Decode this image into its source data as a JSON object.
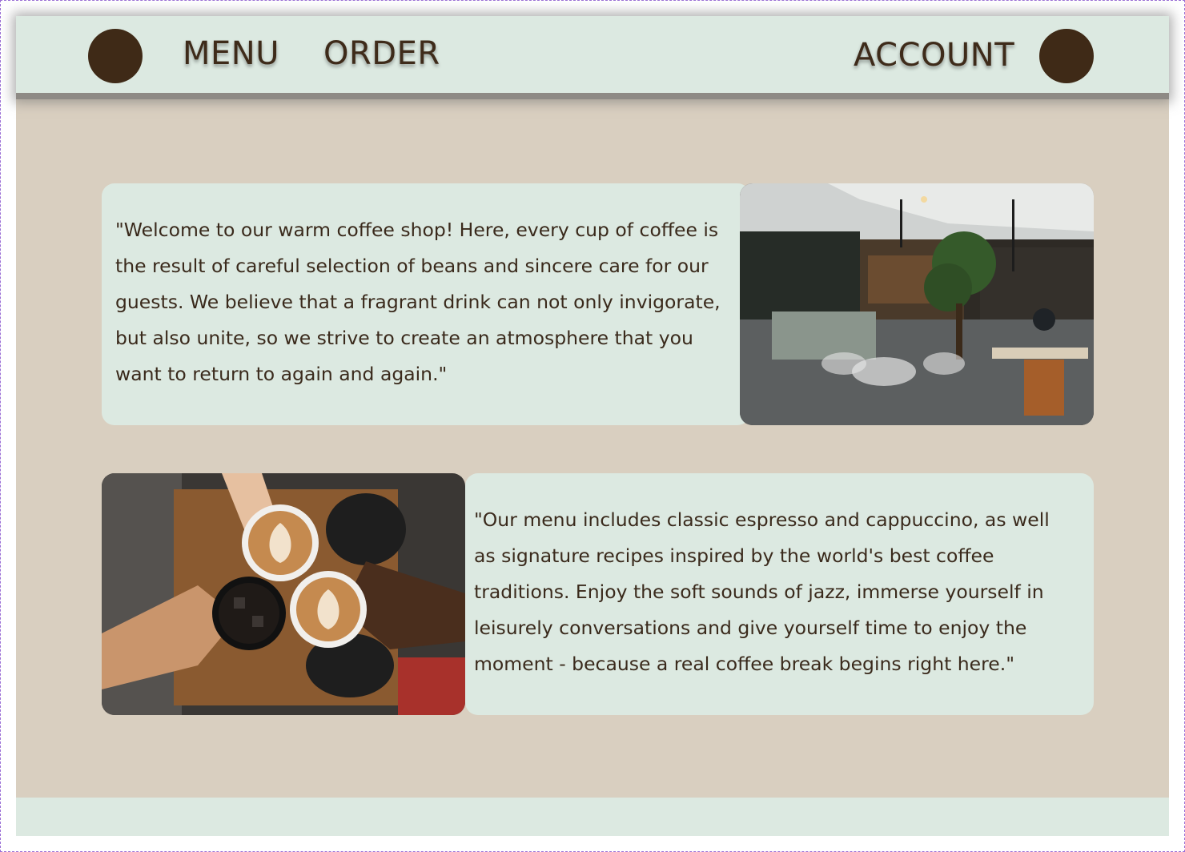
{
  "header": {
    "nav": [
      {
        "label": "MENU"
      },
      {
        "label": "ORDER"
      }
    ],
    "account_label": "ACCOUNT"
  },
  "sections": [
    {
      "text": "\"Welcome to our warm coffee shop! Here, every cup of coffee is the result of careful selection of beans and sincere care for our guests. We believe that a fragrant drink can not only invigorate, but also unite, so we strive to create an atmosphere that you want to return to again and again.\""
    },
    {
      "text": "\"Our menu includes classic espresso and cappuccino, as well as signature recipes inspired by the world's best coffee traditions. Enjoy the soft sounds of jazz, immerse yourself in leisurely conversations and give yourself time to enjoy the moment - because a real coffee break begins right here.\""
    }
  ],
  "colors": {
    "header_bg": "#dce9e1",
    "page_bg": "#d9cfc0",
    "accent_dark": "#3f2a17",
    "text": "#3a2a1c"
  }
}
